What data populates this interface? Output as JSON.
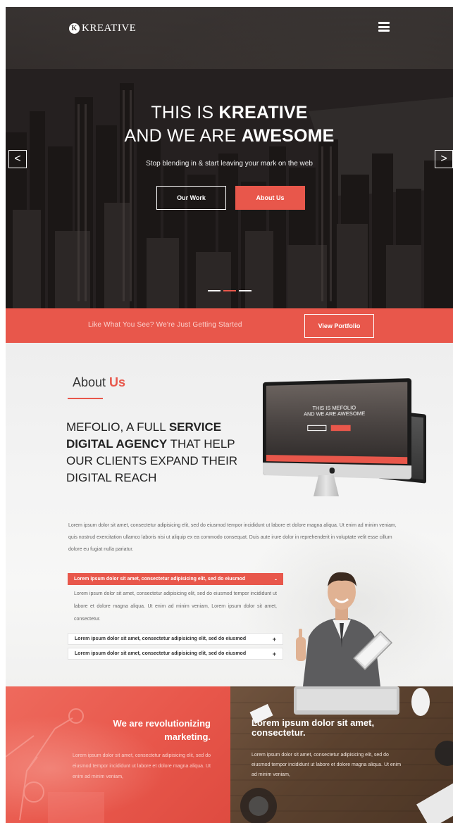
{
  "brand": {
    "logo_mark": "K",
    "logo_text": "KREATIVE"
  },
  "hero": {
    "title_line1_normal": "THIS IS ",
    "title_line1_bold": "KREATIVE",
    "title_line2_normal": "AND WE ARE ",
    "title_line2_bold": "AWESOME",
    "subtitle": "Stop blending in & start leaving your mark on the web",
    "btn_work": "Our Work",
    "btn_about": "About Us",
    "arrow_left": "<",
    "arrow_right": ">",
    "slides_count": 3,
    "active_slide": 2
  },
  "cta": {
    "text": "Like What You See? We're Just Getting Started",
    "button": "View Portfolio"
  },
  "about": {
    "title_normal": "About ",
    "title_accent": "Us",
    "heading_normal1": "MEFOLIO, A FULL ",
    "heading_bold1": "SERVICE DIGITAL AGENCY",
    "heading_normal2": " THAT HELP OUR CLIENTS EXPAND THEIR DIGITAL REACH",
    "paragraph": "Lorem ipsum dolor sit amet, consectetur adipisicing elit, sed do eiusmod tempor incididunt ut labore et dolore magna aliqua. Ut enim ad minim veniam, quis nostrud exercitation ullamco laboris nisi ut aliquip ex ea commodo consequat. Duis aute irure dolor in reprehenderit in voluptate velit esse cillum dolore eu fugiat nulla pariatur.",
    "monitor": {
      "mini_title_line1": "THIS IS MEFOLIO",
      "mini_title_line2": "AND WE ARE AWESOME"
    },
    "accordion": [
      {
        "title": "Lorem ipsum dolor sit amet, consectetur adipisicing elit, sed do eiusmod",
        "sign": "-",
        "open": true,
        "body": "Lorem ipsum dolor sit amet, consectetur adipisicing elit, sed do eiusmod tempor incididunt ut labore et dolore magna aliqua. Ut enim ad minim veniam, Lorem ipsum dolor sit amet, consectetur."
      },
      {
        "title": "Lorem ipsum dolor sit amet, consectetur adipisicing elit, sed do eiusmod",
        "sign": "+",
        "open": false
      },
      {
        "title": "Lorem ipsum dolor sit amet, consectetur adipisicing elit, sed do eiusmod",
        "sign": "+",
        "open": false
      }
    ]
  },
  "bottom_left": {
    "title": "We are revolutionizing marketing.",
    "text": "Lorem ipsum dolor sit amet, consectetur adipisicing elit, sed do eiusmod tempor incididunt ut labore et dolore magna aliqua. Ut enim ad minim veniam,"
  },
  "bottom_right": {
    "title": "Lorem ipsum dolor sit amet, consectetur.",
    "text": "Lorem ipsum dolor sit amet, consectetur adipisicing elit, sed do eiusmod tempor incididunt ut labore et dolore magna aliqua. Ut enim ad minim veniam,"
  },
  "colors": {
    "accent": "#e8574b",
    "dark": "#2d2827",
    "light_bg": "#f3f3f3"
  },
  "icons": {
    "menu": "hamburger-icon",
    "prev": "chevron-left-icon",
    "next": "chevron-right-icon"
  }
}
